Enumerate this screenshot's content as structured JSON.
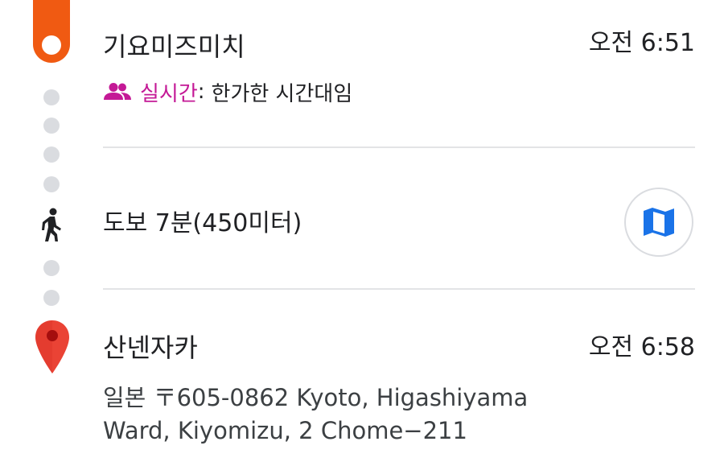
{
  "origin": {
    "name": "기요미즈미치",
    "time": "오전 6:51",
    "realtime_label": "실시간",
    "realtime_separator": ":",
    "realtime_status": "한가한 시간대임"
  },
  "walk": {
    "text": "도보 7분(450미터)",
    "map_button_icon": "map-icon"
  },
  "destination": {
    "name": "산넨자카",
    "time": "오전 6:58",
    "address_line1": "일본 〒605-0862 Kyoto, Higashiyama",
    "address_line2": "Ward, Kiyomizu, 2 Chome−211"
  },
  "colors": {
    "origin_marker": "#f05a12",
    "realtime_accent": "#c41996",
    "map_icon": "#1a73e8",
    "destination_pin": "#ea4335",
    "route_dots": "#dadce0"
  },
  "icons": {
    "origin": "origin-marker-icon",
    "realtime": "people-icon",
    "walk": "walking-person-icon",
    "destination": "location-pin-icon"
  }
}
